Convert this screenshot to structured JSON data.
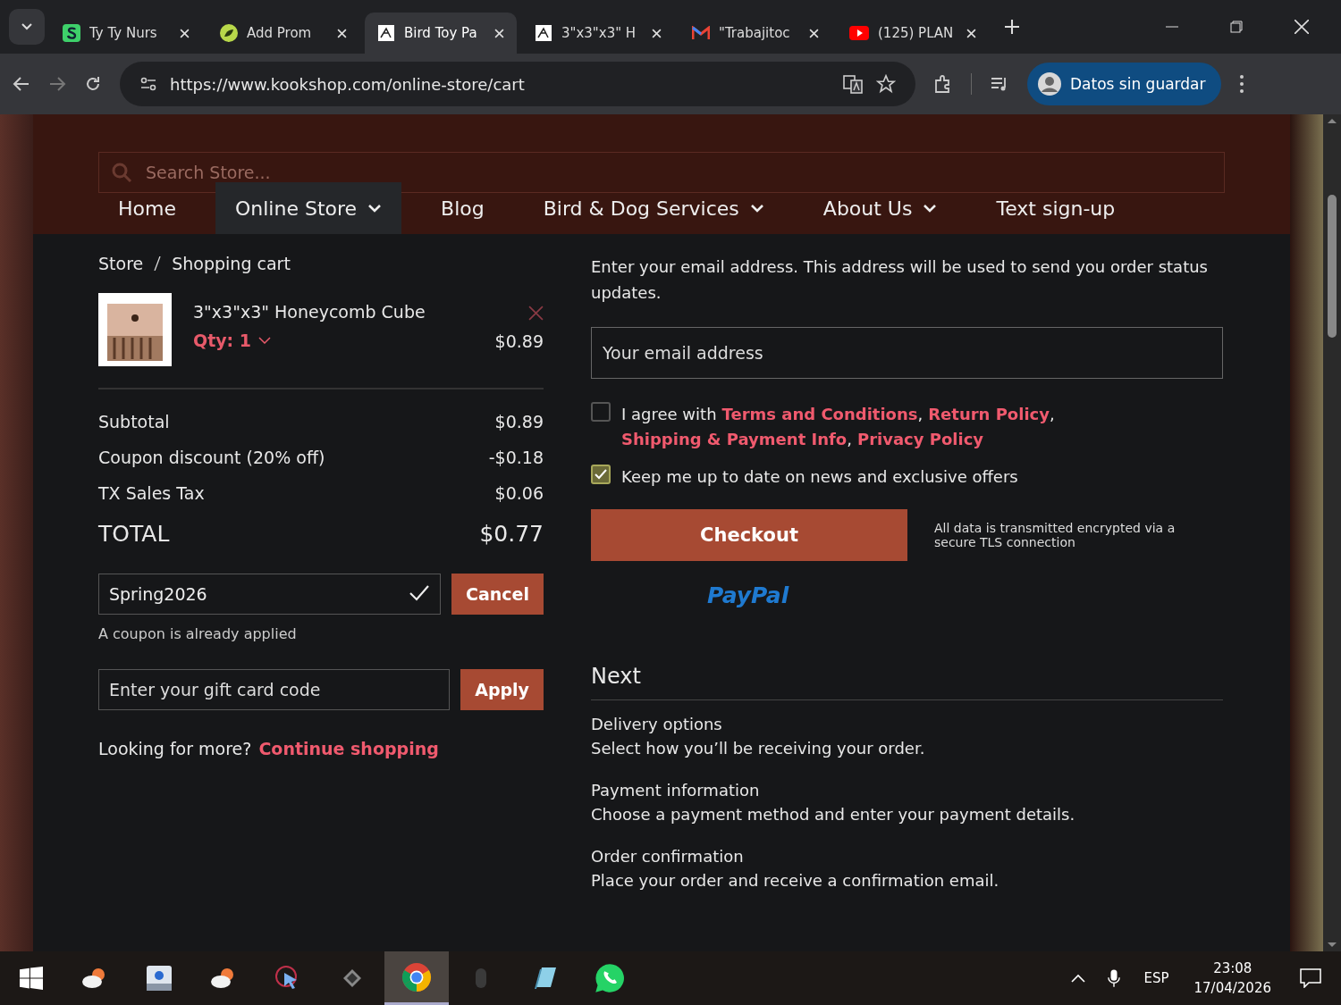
{
  "browser": {
    "tabs": [
      {
        "title": "Ty Ty Nurs",
        "kind": "s-logo",
        "selected": false
      },
      {
        "title": "Add Prom",
        "kind": "leaf",
        "selected": false
      },
      {
        "title": "Bird Toy Pa",
        "kind": "page",
        "selected": true
      },
      {
        "title": "3\"x3\"x3\" H",
        "kind": "page",
        "selected": false
      },
      {
        "title": "\"Trabajitoc",
        "kind": "mail",
        "selected": false
      },
      {
        "title": "(125) PLAN",
        "kind": "video",
        "selected": false
      }
    ],
    "url": "https://www.kookshop.com/online-store/cart",
    "profile": "Datos sin guardar"
  },
  "header": {
    "search_placeholder": "Search Store...",
    "nav": [
      {
        "label": "Home",
        "dropdown": false,
        "selected": false
      },
      {
        "label": "Online Store",
        "dropdown": true,
        "selected": true
      },
      {
        "label": "Blog",
        "dropdown": false,
        "selected": false
      },
      {
        "label": "Bird & Dog Services",
        "dropdown": true,
        "selected": false
      },
      {
        "label": "About Us",
        "dropdown": true,
        "selected": false
      },
      {
        "label": "Text sign-up",
        "dropdown": false,
        "selected": false
      }
    ]
  },
  "cart": {
    "breadcrumb": [
      "Store",
      "Shopping cart"
    ],
    "item": {
      "name": "3\"x3\"x3\" Honeycomb Cube",
      "qty": "Qty: 1",
      "price": "$0.89"
    },
    "totals": [
      {
        "label": "Subtotal",
        "value": "$0.89",
        "kind": "line"
      },
      {
        "label": "Coupon discount (20% off)",
        "value": "-$0.18",
        "kind": "line"
      },
      {
        "label": "TX Sales Tax",
        "value": "$0.06",
        "kind": "line"
      },
      {
        "label": "TOTAL",
        "value": "$0.77",
        "kind": "total"
      }
    ],
    "coupon": {
      "value": "Spring2026",
      "applied": true,
      "button": "Cancel",
      "note": "A coupon is already applied"
    },
    "gift": {
      "placeholder": "Enter your gift card code",
      "button": "Apply"
    },
    "more": "Looking for more?",
    "more_link": "Continue shopping"
  },
  "checkout": {
    "intro": "Enter your email address. This address will be used to send you order status updates.",
    "email_placeholder": "Your email address",
    "agree": {
      "checked": false,
      "text": "I agree with",
      "links": [
        {
          "text": "Terms and Conditions",
          "after": ","
        },
        {
          "text": "Return Policy",
          "after": ","
        },
        {
          "text": "Shipping & Payment Info",
          "after": ","
        },
        {
          "text": "Privacy Policy"
        }
      ]
    },
    "news": {
      "checked": true,
      "text": "Keep me up to date on news and exclusive offers"
    },
    "button": "Checkout",
    "secure_note": "All data is transmitted encrypted via a secure TLS connection",
    "paypal": "PayPal",
    "next_title": "Next",
    "steps": [
      {
        "title": "Delivery options",
        "text": "Select how you’ll be receiving your order."
      },
      {
        "title": "Payment information",
        "text": "Choose a payment method and enter your payment details."
      },
      {
        "title": "Order confirmation",
        "text": "Place your order and receive a confirmation email."
      }
    ]
  },
  "taskbar": {
    "apps": [
      {
        "kind": "weather",
        "selected": false
      },
      {
        "kind": "contacts",
        "selected": false
      },
      {
        "kind": "weather",
        "selected": false
      },
      {
        "kind": "cursor",
        "selected": false
      },
      {
        "kind": "tool",
        "selected": false
      },
      {
        "kind": "chrome",
        "selected": true
      },
      {
        "kind": "mouse",
        "selected": false
      },
      {
        "kind": "notes",
        "selected": false
      },
      {
        "kind": "chat",
        "selected": false
      }
    ],
    "language": "ESP",
    "time": "23:08",
    "date": "17/04/2026"
  }
}
